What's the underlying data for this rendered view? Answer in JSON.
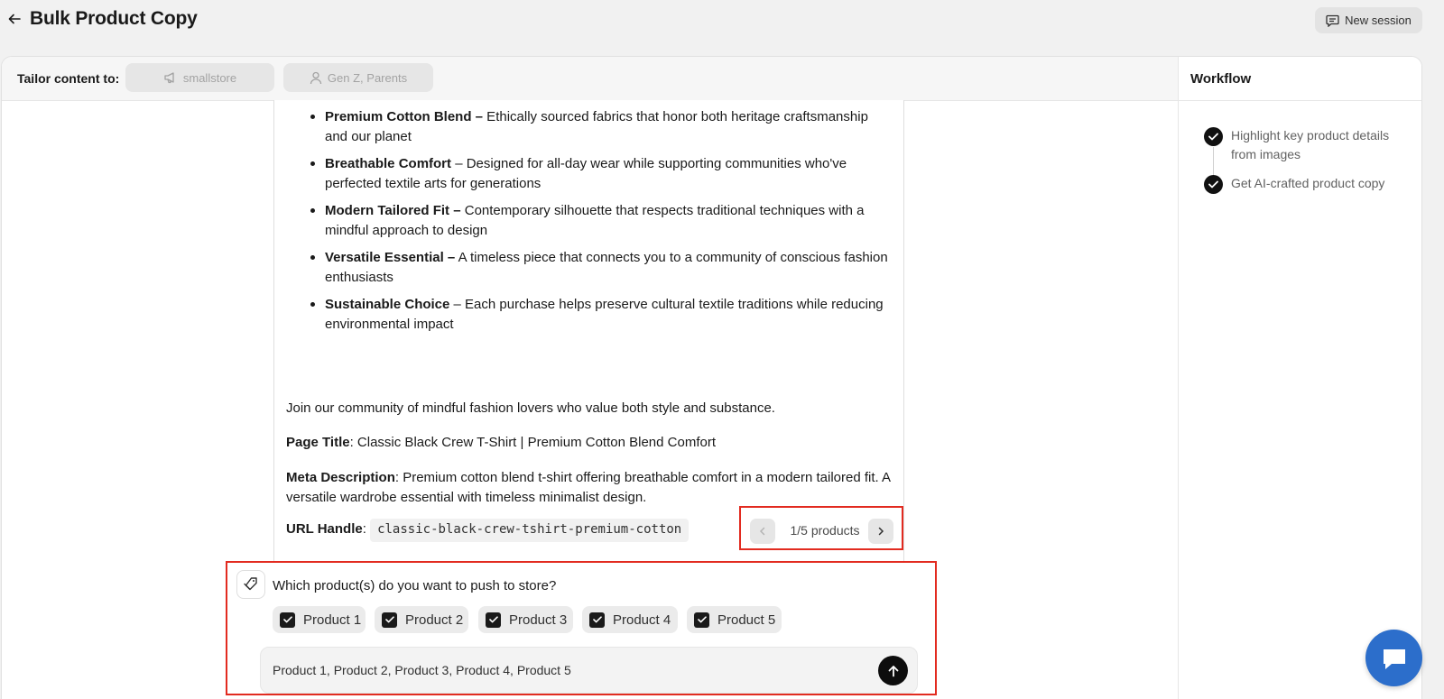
{
  "header": {
    "title": "Bulk Product Copy",
    "new_session_label": "New session"
  },
  "tailor": {
    "label": "Tailor content to:",
    "store_chip": "smallstore",
    "audience_chip": "Gen Z, Parents"
  },
  "workflow": {
    "title": "Workflow",
    "steps": [
      {
        "label": "Highlight key product details from images",
        "done": true
      },
      {
        "label": "Get AI-crafted product copy",
        "done": true
      }
    ]
  },
  "copy": {
    "bullets": [
      {
        "bold": "Premium Cotton Blend –",
        "text": " Ethically sourced fabrics that honor both heritage craftsmanship and our planet"
      },
      {
        "bold": "Breathable Comfort",
        "text": " – Designed for all-day wear while supporting communities who've perfected textile arts for generations"
      },
      {
        "bold": "Modern Tailored Fit –",
        "text": " Contemporary silhouette that respects traditional techniques with a mindful approach to design"
      },
      {
        "bold": "Versatile Essential –",
        "text": " A timeless piece that connects you to a community of conscious fashion enthusiasts"
      },
      {
        "bold": "Sustainable Choice",
        "text": " – Each purchase helps preserve cultural textile traditions while reducing environmental impact"
      }
    ],
    "closing": "Join our community of mindful fashion lovers who value both style and substance.",
    "page_title_label": "Page Title",
    "page_title_value": ": Classic Black Crew T-Shirt | Premium Cotton Blend Comfort",
    "meta_label": "Meta Description",
    "meta_value": ": Premium cotton blend t-shirt offering breathable comfort in a modern tailored fit. A versatile wardrobe essential with timeless minimalist design.",
    "url_label": "URL Handle",
    "url_sep": ":",
    "url_value": "classic-black-crew-tshirt-premium-cotton"
  },
  "pager": {
    "label": "1/5 products"
  },
  "push": {
    "question": "Which product(s) do you want to push to store?",
    "options": [
      {
        "label": "Product 1",
        "checked": true
      },
      {
        "label": "Product 2",
        "checked": true
      },
      {
        "label": "Product 3",
        "checked": true
      },
      {
        "label": "Product 4",
        "checked": true
      },
      {
        "label": "Product 5",
        "checked": true
      }
    ],
    "input_value": "Product 1, Product 2, Product 3, Product 4, Product 5"
  },
  "icons": {
    "back": "arrow-left-icon",
    "new_session": "chat-bubble-icon",
    "store": "megaphone-icon",
    "audience": "person-icon",
    "check": "checkmark-icon",
    "bot": "tag-icon",
    "send": "arrow-up-icon",
    "support": "chat-icon"
  },
  "colors": {
    "highlight_border": "#e22b20",
    "chat_bubble": "#2c6ecb",
    "send_button": "#0d0d0d"
  }
}
